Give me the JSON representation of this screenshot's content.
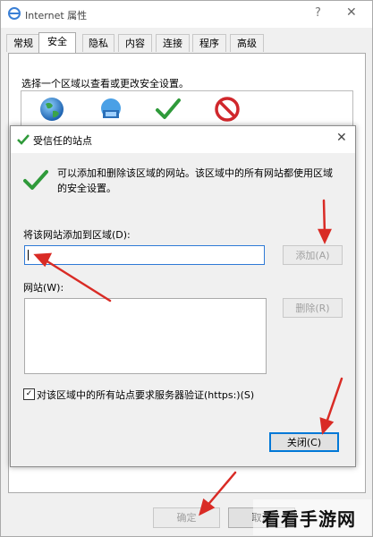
{
  "outer_window": {
    "title": "Internet 属性",
    "help_glyph": "?",
    "close_glyph": "✕",
    "tabs": [
      "常规",
      "安全",
      "隐私",
      "内容",
      "连接",
      "程序",
      "高级"
    ],
    "active_tab": "安全",
    "zone_prompt": "选择一个区域以查看或更改安全设置。",
    "zone_icons": [
      "internet-globe-icon",
      "local-intranet-icon",
      "trusted-sites-check-icon",
      "restricted-sites-icon"
    ],
    "ok_label": "确定",
    "cancel_label": "取消"
  },
  "dialog": {
    "title": "受信任的站点",
    "close_glyph": "✕",
    "description": "可以添加和删除该区域的网站。该区域中的所有网站都使用区域的安全设置。",
    "add_label": "将该网站添加到区域(D):",
    "url_value": "",
    "add_button": "添加(A)",
    "sites_label": "网站(W):",
    "sites": [],
    "remove_button": "删除(R)",
    "https_label": "对该区域中的所有站点要求服务器验证(https:)(S)",
    "https_checked": true,
    "close_button": "关闭(C)"
  },
  "watermark": {
    "text": "看看手游网"
  },
  "colors": {
    "arrow": "#d92b25",
    "check_green": "#2f9a3a",
    "focus_blue": "#2f7ad6"
  }
}
